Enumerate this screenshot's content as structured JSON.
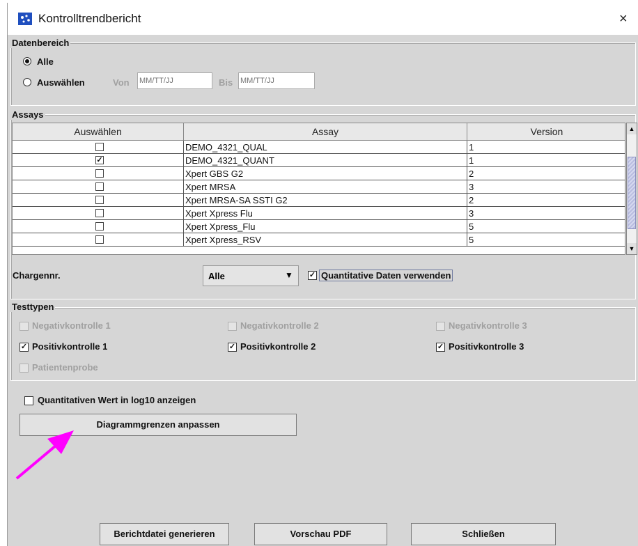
{
  "window": {
    "title": "Kontrolltrendbericht",
    "close_glyph": "×"
  },
  "datenbereich": {
    "legend": "Datenbereich",
    "option_all": "Alle",
    "option_select": "Auswählen",
    "from_label": "Von",
    "from_placeholder": "MM/TT/JJ",
    "to_label": "Bis",
    "to_placeholder": "MM/TT/JJ"
  },
  "assays": {
    "legend": "Assays",
    "columns": [
      "Auswählen",
      "Assay",
      "Version"
    ],
    "rows": [
      {
        "checked": false,
        "assay": "DEMO_4321_QUAL",
        "version": "1"
      },
      {
        "checked": true,
        "assay": "DEMO_4321_QUANT",
        "version": "1"
      },
      {
        "checked": false,
        "assay": "Xpert GBS G2",
        "version": "2"
      },
      {
        "checked": false,
        "assay": "Xpert MRSA",
        "version": "3"
      },
      {
        "checked": false,
        "assay": "Xpert MRSA-SA SSTI G2",
        "version": "2"
      },
      {
        "checked": false,
        "assay": "Xpert Xpress Flu",
        "version": "3"
      },
      {
        "checked": false,
        "assay": "Xpert Xpress_Flu",
        "version": "5"
      },
      {
        "checked": false,
        "assay": "Xpert Xpress_RSV",
        "version": "5"
      }
    ],
    "lot_label": "Chargennr.",
    "lot_value": "Alle",
    "quant_label": "Quantitative Daten verwenden"
  },
  "testtypen": {
    "legend": "Testtypen",
    "neg1": "Negativkontrolle 1",
    "neg2": "Negativkontrolle 2",
    "neg3": "Negativkontrolle 3",
    "pos1": "Positivkontrolle 1",
    "pos2": "Positivkontrolle 2",
    "pos3": "Positivkontrolle 3",
    "patient": "Patientenprobe"
  },
  "options": {
    "log10_label": "Quantitativen Wert in log10 anzeigen",
    "chart_limits_button": "Diagrammgrenzen anpassen"
  },
  "footer": {
    "generate_button": "Berichtdatei generieren",
    "preview_button": "Vorschau PDF",
    "close_button": "Schließen"
  },
  "colors": {
    "annotation_arrow": "#ff00ff",
    "scroll_thumb": "#b9bde0"
  },
  "icons": [
    "app-icon",
    "close-icon",
    "dropdown-arrow-icon",
    "scroll-up-icon",
    "scroll-down-icon",
    "annotation-arrow-icon"
  ]
}
